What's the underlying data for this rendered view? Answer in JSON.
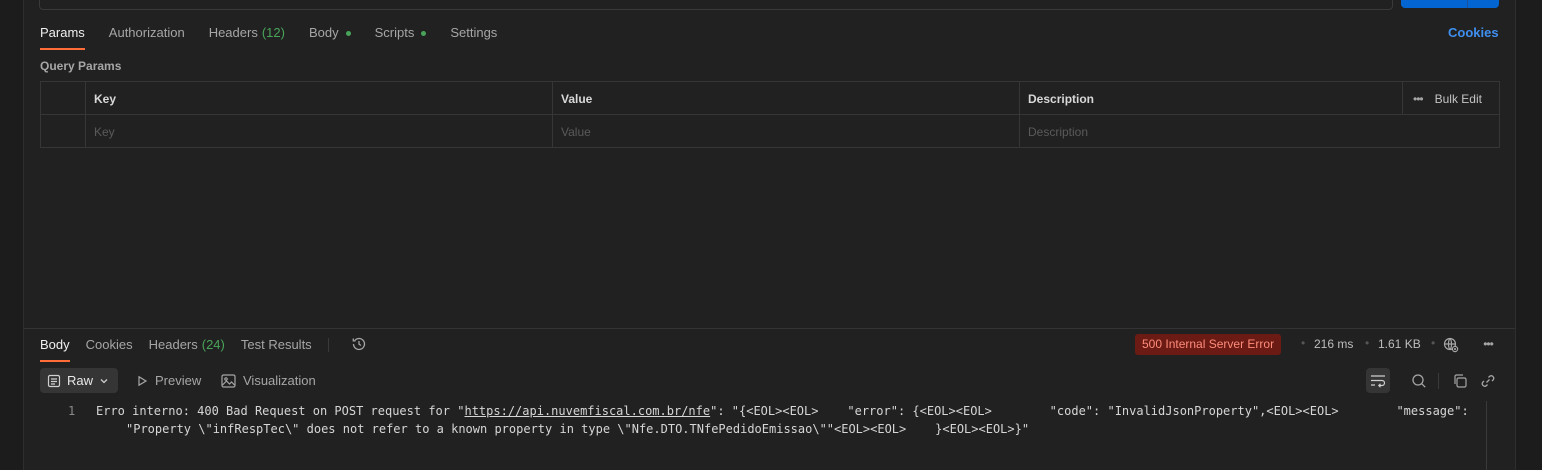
{
  "request_tabs": [
    {
      "label": "Params",
      "active": true
    },
    {
      "label": "Authorization"
    },
    {
      "label": "Headers",
      "count": "(12)"
    },
    {
      "label": "Body",
      "dot": true
    },
    {
      "label": "Scripts",
      "dot": true
    },
    {
      "label": "Settings"
    }
  ],
  "cookies_link": "Cookies",
  "query_params": {
    "title": "Query Params",
    "columns": {
      "key": "Key",
      "value": "Value",
      "description": "Description"
    },
    "bulk_edit": "Bulk Edit",
    "more_icon": "•••",
    "placeholders": {
      "key": "Key",
      "value": "Value",
      "description": "Description"
    }
  },
  "response_tabs": [
    {
      "label": "Body",
      "active": true
    },
    {
      "label": "Cookies"
    },
    {
      "label": "Headers",
      "count": "(24)"
    },
    {
      "label": "Test Results"
    }
  ],
  "response_meta": {
    "status": "500 Internal Server Error",
    "time": "216 ms",
    "size": "1.61 KB",
    "status_color": "#ff8c7a"
  },
  "format_bar": {
    "raw": "Raw",
    "preview": "Preview",
    "visualization": "Visualization"
  },
  "editor": {
    "line_number": "1",
    "line1_prefix": "Erro interno: 400 Bad Request on POST request for \"",
    "url": "https://api.nuvemfiscal.com.br/nfe",
    "line1_suffix": "\": \"{<EOL><EOL>    \"error\": {<EOL><EOL>        \"code\": \"InvalidJsonProperty\",<EOL><EOL>        \"message\":",
    "line2": "\"Property \\\"infRespTec\\\" does not refer to a known property in type \\\"Nfe.DTO.TNfePedidoEmissao\\\"\"<EOL><EOL>    }<EOL><EOL>}\""
  },
  "colors": {
    "accent_tab": "#ff6c37",
    "link": "#3f8ff0",
    "count_green": "#49a45a",
    "send_button": "#0265d2"
  }
}
